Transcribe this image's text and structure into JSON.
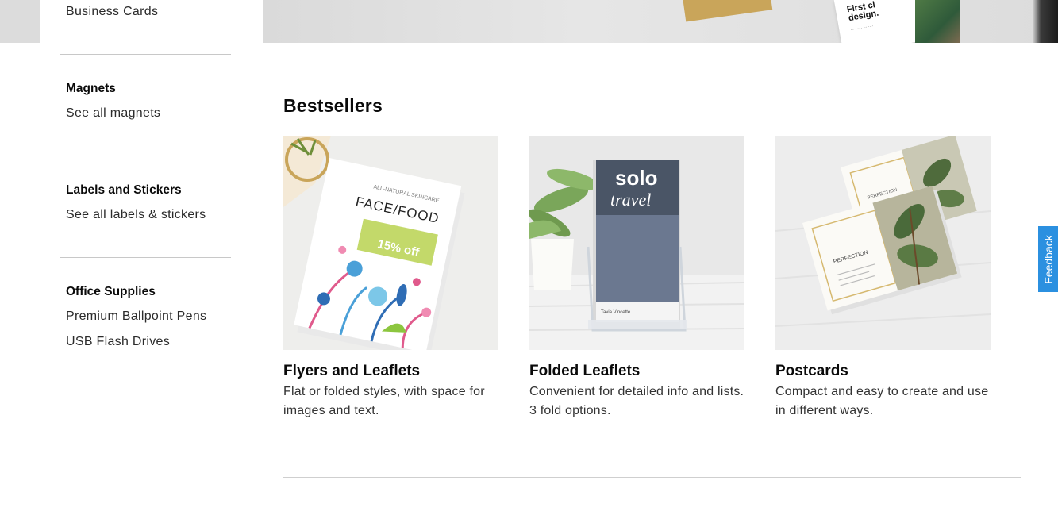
{
  "sidebar": {
    "top_link": "Business Cards",
    "groups": [
      {
        "heading": "Magnets",
        "links": [
          "See all magnets"
        ]
      },
      {
        "heading": "Labels and Stickers",
        "links": [
          "See all labels & stickers"
        ]
      },
      {
        "heading": "Office Supplies",
        "links": [
          "Premium Ballpoint Pens",
          "USB Flash Drives"
        ]
      }
    ]
  },
  "hero": {
    "card_text": "First cl... design.",
    "card_line1": "First cl",
    "card_line2": "design."
  },
  "main": {
    "section_title": "Bestsellers",
    "products": [
      {
        "name": "Flyers and Leaflets",
        "description": "Flat or folded styles, with space for images and text.",
        "image_text": {
          "small": "ALL-NATURAL SKINCARE",
          "title": "FACE/FOOD",
          "offer": "15% off"
        }
      },
      {
        "name": "Folded Leaflets",
        "description": "Convenient for detailed info and lists. 3 fold options.",
        "image_text": {
          "title1": "solo",
          "title2": "travel",
          "footer": "Tavia Vincette"
        }
      },
      {
        "name": "Postcards",
        "description": "Compact and easy to create and use in different ways.",
        "image_text": {
          "title": "PERFECTION"
        }
      }
    ]
  },
  "feedback": {
    "label": "Feedback"
  },
  "colors": {
    "feedback": "#2b90e0",
    "offer_green": "#c3d96a",
    "divider": "#c8c8c8"
  }
}
